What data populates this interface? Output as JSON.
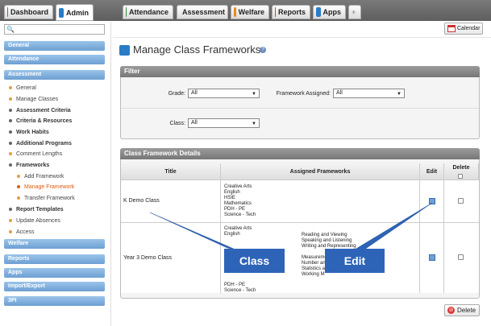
{
  "top_tabs": [
    {
      "label": "Dashboard",
      "icon": "home-icon",
      "color": "#3b73b9"
    },
    {
      "label": "Admin",
      "icon": "admin-icon",
      "color": "#2a7cc7"
    },
    {
      "label": "Attendance",
      "icon": "grid-icon",
      "color": "#2f8f3b"
    },
    {
      "label": "Assessment",
      "icon": "assessment-icon",
      "color": "#c9312c"
    },
    {
      "label": "Welfare",
      "icon": "welfare-icon",
      "color": "#e88a20"
    },
    {
      "label": "Reports",
      "icon": "reports-icon",
      "color": "#b05a1a"
    },
    {
      "label": "Apps",
      "icon": "apps-icon",
      "color": "#2a7cc7"
    }
  ],
  "calendar_label": "Calendar",
  "sidebar": {
    "sections": [
      "General",
      "Attendance",
      "Assessment",
      "Welfare",
      "Reports",
      "Apps",
      "Import/Export",
      "3PI"
    ],
    "assessment_items": [
      {
        "label": "General",
        "style": "normal"
      },
      {
        "label": "Manage Classes",
        "style": "normal"
      },
      {
        "label": "Assessment Criteria",
        "style": "bold"
      },
      {
        "label": "Criteria & Resources",
        "style": "bold"
      },
      {
        "label": "Work Habits",
        "style": "bold"
      },
      {
        "label": "Additional Programs",
        "style": "bold"
      },
      {
        "label": "Comment Lengths",
        "style": "normal"
      },
      {
        "label": "Frameworks",
        "style": "bold"
      }
    ],
    "framework_items": [
      {
        "label": "Add Framework",
        "style": "normal"
      },
      {
        "label": "Manage Framework",
        "style": "orange"
      },
      {
        "label": "Transfer Framework",
        "style": "normal"
      }
    ],
    "tail_items": [
      {
        "label": "Report Templates",
        "style": "bold"
      },
      {
        "label": "Update Absences",
        "style": "normal"
      },
      {
        "label": "Access",
        "style": "normal"
      }
    ]
  },
  "page_title": "Manage Class Frameworks",
  "filter": {
    "header": "Filter",
    "grade_label": "Grade:",
    "grade_value": "All",
    "framework_label": "Framework Assigned:",
    "framework_value": "All",
    "class_label": "Class:",
    "class_value": "All"
  },
  "details": {
    "header": "Class Framework Details",
    "columns": [
      "Title",
      "Assigned Frameworks",
      "Edit",
      "Delete"
    ],
    "rows": [
      {
        "title": "K Demo Class",
        "frameworks_left": "Creative Arts\nEnglish\nHSIE\nMathematics\nPDH - PE\nScience - Tech",
        "frameworks_right": ""
      },
      {
        "title": "Year 3 Demo Class",
        "frameworks_left": "Creative Arts\nEnglish\n\n\n\n\n\n\n\n\nPDH - PE\nScience - Tech",
        "frameworks_right": "Reading and Viewing\nSpeaking and Listening\nWriting and Representing\n\nMeasureme\nNumber an\nStatistics a\nWorking M"
      }
    ]
  },
  "delete_label": "Delete",
  "callouts": {
    "class": "Class",
    "edit": "Edit"
  }
}
